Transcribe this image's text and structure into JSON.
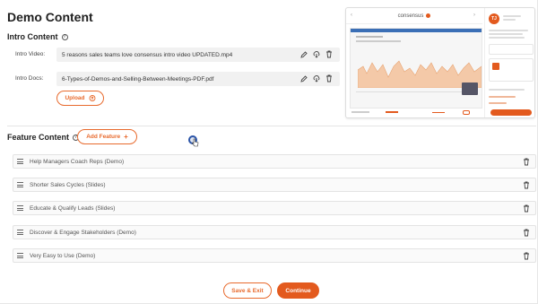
{
  "page": {
    "title": "Demo Content"
  },
  "intro": {
    "title": "Intro Content",
    "video_label": "Intro Video:",
    "video_file": "5 reasons sales teams love consensus intro video UPDATED.mp4",
    "docs_label": "Intro Docs:",
    "docs_file": "6-Types-of-Demos-and-Selling-Between-Meetings-PDF.pdf",
    "upload_label": "Upload"
  },
  "features": {
    "title": "Feature Content",
    "add_label": "Add Feature",
    "items": [
      {
        "label": "Help Managers Coach Reps (Demo)"
      },
      {
        "label": "Shorter Sales Cycles (Slides)"
      },
      {
        "label": "Educate & Qualify Leads (Slides)"
      },
      {
        "label": "Discover & Engage Stakeholders (Demo)"
      },
      {
        "label": "Very Easy to Use (Demo)"
      }
    ]
  },
  "footer": {
    "save_exit_label": "Save & Exit",
    "continue_label": "Continue"
  },
  "preview": {
    "brand": "consensus",
    "avatar_initials": "TJ"
  },
  "colors": {
    "accent": "#e35a1e",
    "accent_outline": "#e86a2d"
  },
  "icons": {
    "edit": "pencil-icon",
    "download": "cloud-download-icon",
    "delete": "trash-icon",
    "help": "help-circle-icon",
    "drag": "drag-handle-icon"
  }
}
